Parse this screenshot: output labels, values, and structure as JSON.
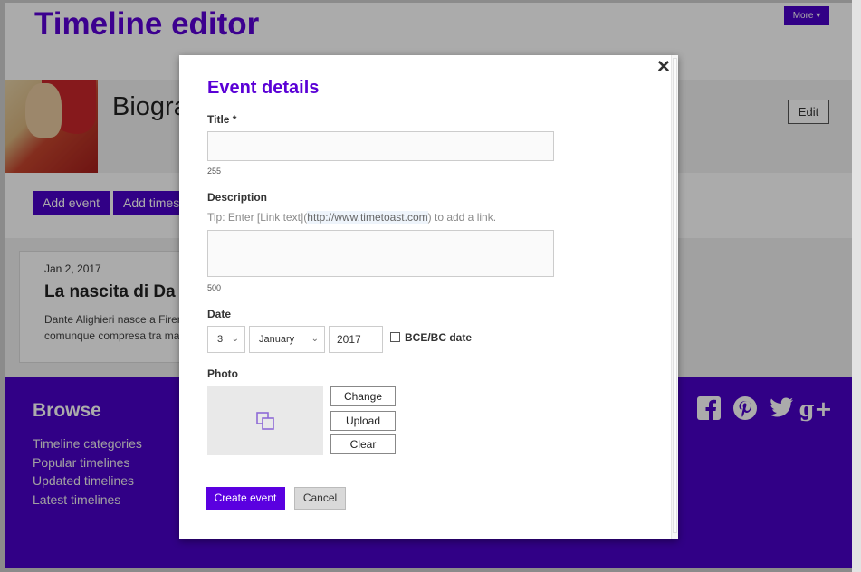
{
  "page": {
    "title": "Timeline editor",
    "more_label": "More ▾",
    "banner_title": "Biogra",
    "edit_label": "Edit",
    "toolbar": {
      "add_event": "Add event",
      "add_timespan": "Add times"
    },
    "event_card": {
      "date": "Jan 2, 2017",
      "title": "La nascita di Da",
      "description_lines": [
        "Dante Alighieri nasce a Firen",
        "comunque compresa tra ma"
      ]
    },
    "footer": {
      "heading": "Browse",
      "links": [
        "Timeline categories",
        "Popular timelines",
        "Updated timelines",
        "Latest timelines"
      ]
    },
    "social": [
      {
        "name": "facebook-icon",
        "glyph": "f"
      },
      {
        "name": "pinterest-icon",
        "glyph": "P"
      },
      {
        "name": "twitter-icon",
        "glyph": "t"
      },
      {
        "name": "google-plus-icon",
        "glyph": "g+"
      }
    ]
  },
  "modal": {
    "close_glyph": "✕",
    "title": "Event details",
    "title_label": "Title *",
    "title_value": "",
    "title_count": "255",
    "description_label": "Description",
    "tip_prefix": "Tip: Enter [Link text](",
    "tip_link": "http://www.timetoast.com",
    "tip_suffix": ") to add a link.",
    "description_value": "",
    "description_count": "500",
    "date_label": "Date",
    "day": "3",
    "month": "January",
    "year": "2017",
    "bce_label": "BCE/BC date",
    "photo_label": "Photo",
    "change_label": "Change",
    "upload_label": "Upload",
    "clear_label": "Clear",
    "create_label": "Create event",
    "cancel_label": "Cancel"
  },
  "colors": {
    "accent": "#5a00d6",
    "footer": "#4a00c8"
  }
}
